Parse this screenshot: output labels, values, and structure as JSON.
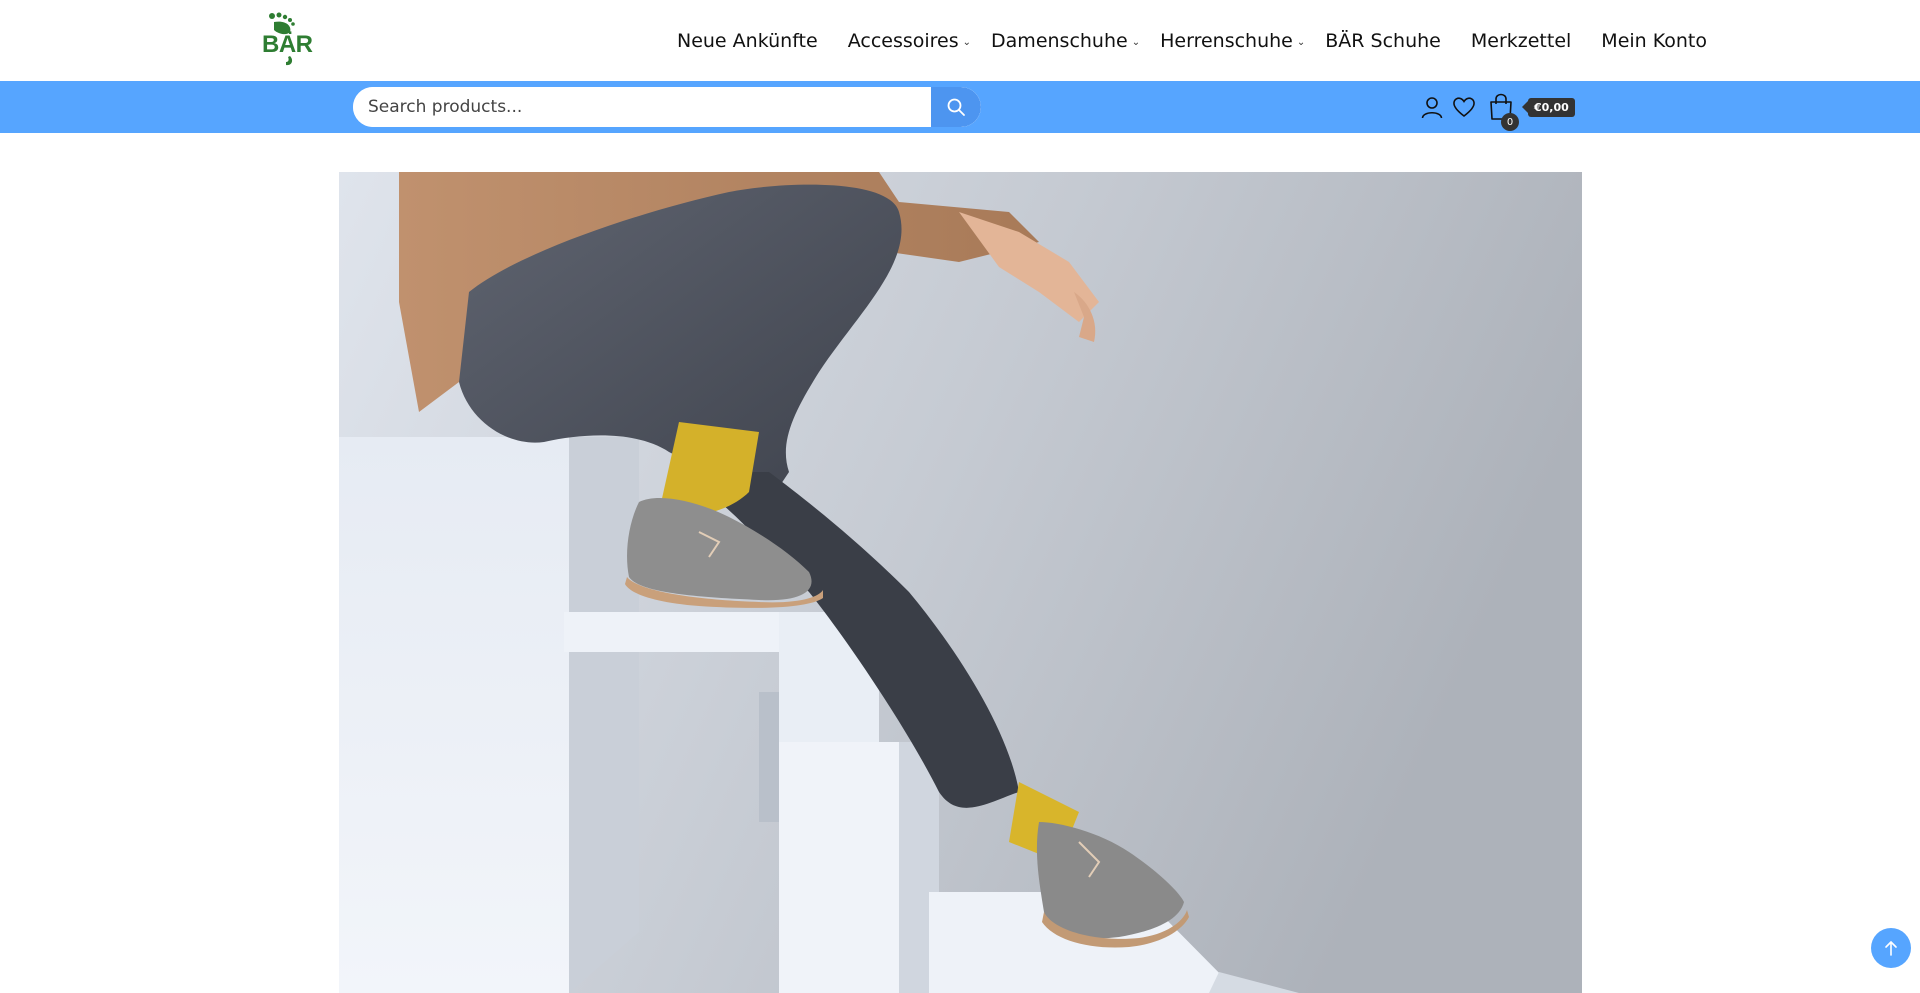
{
  "header": {
    "logo_text": "BÄR",
    "nav": [
      {
        "label": "Neue Ankünfte",
        "has_dropdown": false
      },
      {
        "label": "Accessoires",
        "has_dropdown": true
      },
      {
        "label": "Damenschuhe",
        "has_dropdown": true
      },
      {
        "label": "Herrenschuhe",
        "has_dropdown": true
      },
      {
        "label": "BÄR Schuhe",
        "has_dropdown": false
      },
      {
        "label": "Merkzettel",
        "has_dropdown": false
      },
      {
        "label": "Mein Konto",
        "has_dropdown": false
      }
    ]
  },
  "search": {
    "placeholder": "Search products...",
    "value": ""
  },
  "cart": {
    "count": "0",
    "total": "€0,00"
  },
  "colors": {
    "accent_bar": "#56a5ff",
    "search_button": "#4d95f0",
    "logo_green": "#2e7d32",
    "cart_badge": "#333333"
  },
  "icons": {
    "search": "search-icon",
    "account": "user-icon",
    "wishlist": "heart-icon",
    "cart": "shopping-bag-icon",
    "back_to_top": "arrow-up-icon"
  }
}
